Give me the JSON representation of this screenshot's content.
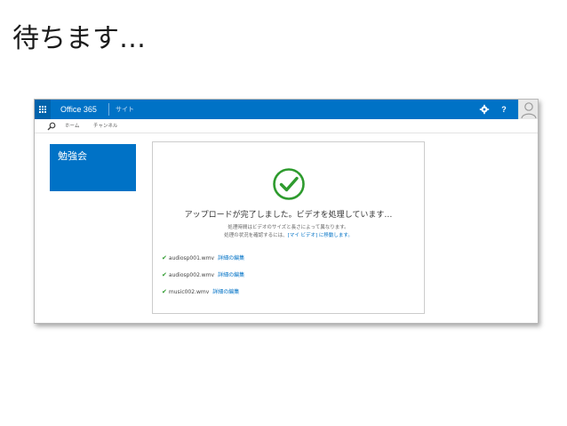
{
  "slide": {
    "title": "待ちます…"
  },
  "suitebar": {
    "brand": "Office 365",
    "site_link": "サイト",
    "help_label": "?",
    "accent_color": "#0072c6",
    "icons": [
      "waffle-icon",
      "gear-icon",
      "help-icon",
      "avatar-icon"
    ]
  },
  "subnav": {
    "links": [
      "ホーム",
      "チャンネル"
    ]
  },
  "site_tile": {
    "title": "勉強会"
  },
  "upload_panel": {
    "heading": "アップロードが完了しました。ビデオを処理しています…",
    "note_line1": "処理時間はビデオのサイズと長さによって異なります。",
    "note_line2_prefix": "処理の状況を確認するには、",
    "note_line2_link": "[マイ ビデオ] に移動します。",
    "files": [
      {
        "name": "audiosp001.wmv",
        "action": "詳細の編集"
      },
      {
        "name": "audiosp002.wmv",
        "action": "詳細の編集"
      },
      {
        "name": "music002.wmv",
        "action": "詳細の編集"
      }
    ],
    "success_color": "#2e9b2e"
  }
}
